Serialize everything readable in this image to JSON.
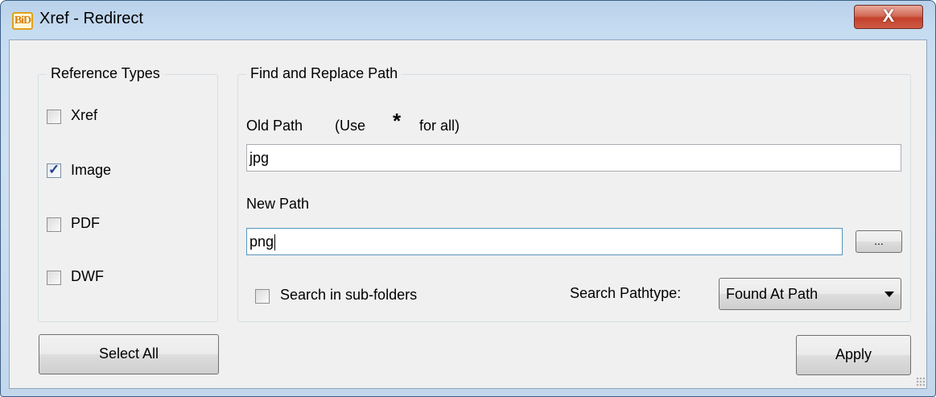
{
  "window": {
    "title": "Xref - Redirect",
    "logo_text": "BiD",
    "close_symbol": "X"
  },
  "reference_types": {
    "legend": "Reference Types",
    "items": [
      {
        "label": "Xref",
        "checked": false
      },
      {
        "label": "Image",
        "checked": true
      },
      {
        "label": "PDF",
        "checked": false
      },
      {
        "label": "DWF",
        "checked": false
      }
    ],
    "check_symbol": "✓"
  },
  "find_replace": {
    "legend": "Find and Replace Path",
    "old_path_label": "Old Path",
    "old_path_hint_prefix": "(Use",
    "old_path_hint_symbol": "*",
    "old_path_hint_suffix": "for all)",
    "old_path_value": "jpg",
    "new_path_label": "New Path",
    "new_path_value": "png",
    "browse_label": "...",
    "search_subfolders_label": "Search in sub-folders",
    "search_subfolders_checked": false,
    "pathtype_label": "Search Pathtype:",
    "pathtype_value": "Found At Path"
  },
  "buttons": {
    "select_all": "Select All",
    "apply": "Apply"
  }
}
